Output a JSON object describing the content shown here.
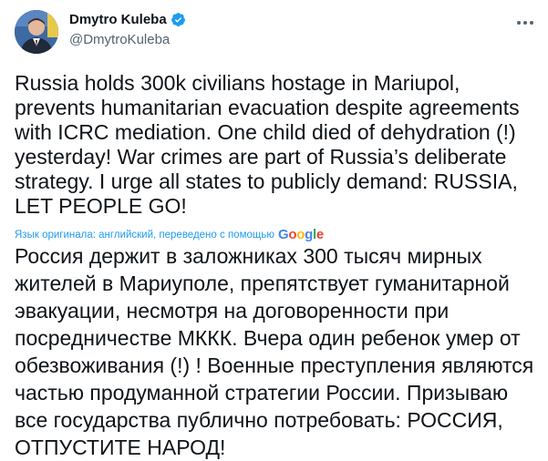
{
  "author": {
    "display_name": "Dmytro Kuleba",
    "handle": "@DmytroKuleba"
  },
  "tweet": {
    "original_text": "Russia holds 300k civilians hostage in Mariupol,\nprevents humanitarian evacuation despite agreements\nwith ICRC mediation. One child died of dehydration (!)\nyesterday! War crimes are part of Russia’s deliberate\nstrategy. I urge all states to publicly demand: RUSSIA,\nLET PEOPLE GO!",
    "translation_note": "Язык оригинала: английский, переведено с помощью",
    "translation_provider": {
      "letters": [
        "G",
        "o",
        "o",
        "g",
        "l",
        "e"
      ],
      "colors": [
        "#4285F4",
        "#EA4335",
        "#FBBC05",
        "#4285F4",
        "#34A853",
        "#EA4335"
      ]
    },
    "translated_text": "Россия держит в заложниках 300 тысяч мирных\nжителей в Мариуполе, препятствует гуманитарной\nэвакуации, несмотря на договоренности при\nпосредничестве МККК. Вчера один ребенок умер от\nобезвоживания (!) ! Военные преступления являются\nчастью продуманной стратегии России. Призываю\nвсе государства публично потребовать: РОССИЯ,\nОТПУСТИТЕ НАРОД!"
  },
  "icons": {
    "verified": "verified-badge-icon",
    "more": "more-options-icon",
    "avatar": "profile-photo"
  },
  "colors": {
    "text_primary": "#0f1419",
    "text_secondary": "#536471",
    "link": "#1d9bf0"
  }
}
